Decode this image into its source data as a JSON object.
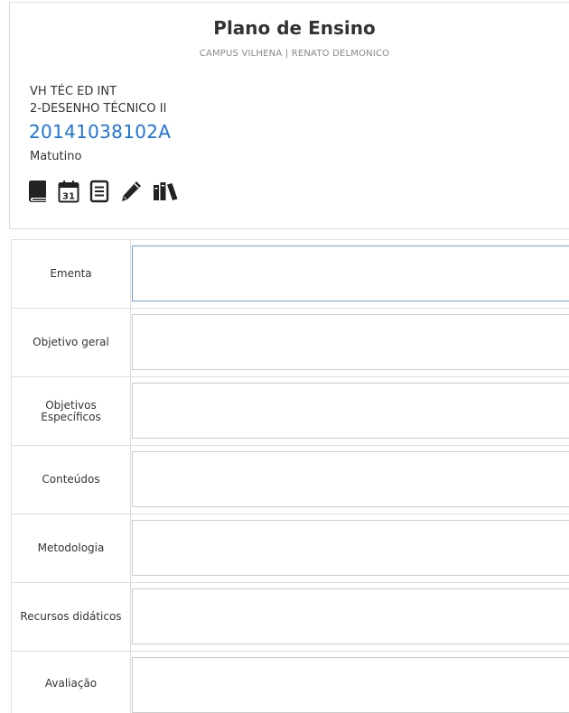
{
  "header": {
    "title": "Plano de Ensino",
    "subtitle": "CAMPUS VILHENA | RENATO DELMONICO"
  },
  "course": {
    "line1": "VH TÉC ED INT",
    "line2": "2-DESENHO TÉCNICO II",
    "code": "20141038102A",
    "shift": "Matutino"
  },
  "icons": [
    {
      "name": "book-icon"
    },
    {
      "name": "calendar-icon"
    },
    {
      "name": "document-icon"
    },
    {
      "name": "pencil-icon"
    },
    {
      "name": "library-icon"
    }
  ],
  "colors": {
    "code_blue": "#1e73d8",
    "border": "#dddddd",
    "focus_border": "#6a9fd4"
  },
  "form": {
    "rows": [
      {
        "label": "Ementa",
        "value": ""
      },
      {
        "label": "Objetivo geral",
        "value": ""
      },
      {
        "label": "Objetivos Específicos",
        "value": ""
      },
      {
        "label": "Conteúdos",
        "value": ""
      },
      {
        "label": "Metodologia",
        "value": ""
      },
      {
        "label": "Recursos didáticos",
        "value": ""
      },
      {
        "label": "Avaliação",
        "value": ""
      }
    ]
  }
}
